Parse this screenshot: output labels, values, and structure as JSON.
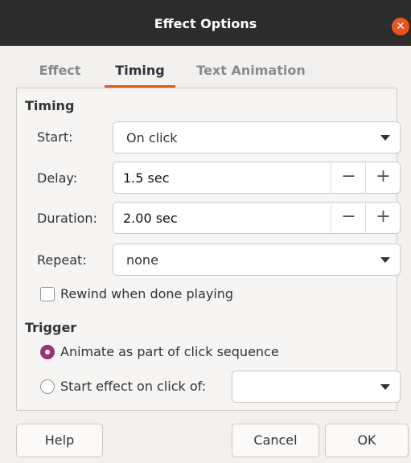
{
  "window": {
    "title": "Effect Options",
    "close_glyph": "✕"
  },
  "tabs": [
    {
      "label": "Effect",
      "active": false
    },
    {
      "label": "Timing",
      "active": true
    },
    {
      "label": "Text Animation",
      "active": false
    }
  ],
  "timing": {
    "section_title": "Timing",
    "start": {
      "label": "Start:",
      "value": "On click"
    },
    "delay": {
      "label": "Delay:",
      "value": "1.5 sec"
    },
    "duration": {
      "label": "Duration:",
      "value": "2.00 sec"
    },
    "repeat": {
      "label": "Repeat:",
      "value": "none"
    },
    "rewind": {
      "label": "Rewind when done playing",
      "checked": false
    }
  },
  "trigger": {
    "section_title": "Trigger",
    "option_sequence": {
      "label": "Animate as part of click sequence",
      "selected": true
    },
    "option_click_of": {
      "label": "Start effect on click of:",
      "selected": false,
      "value": ""
    }
  },
  "spin_glyphs": {
    "minus": "−",
    "plus": "+"
  },
  "buttons": {
    "help": "Help",
    "cancel": "Cancel",
    "ok": "OK"
  },
  "colors": {
    "accent": "#e95420",
    "radio_selected": "#9b2f78",
    "titlebar": "#2c2c2c"
  }
}
